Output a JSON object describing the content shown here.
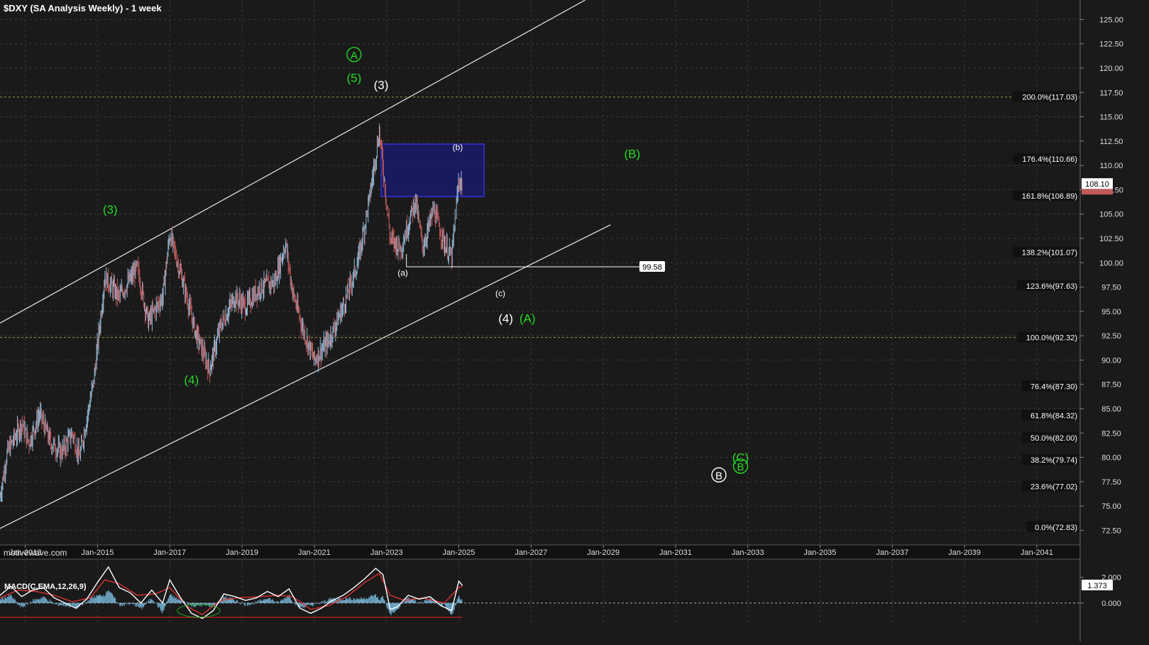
{
  "chart_title": "$DXY (SA Analysis Weekly) - 1 week",
  "watermark": "motivewave.com",
  "colors": {
    "background": "#1a1a1a",
    "grid": "#3a3a3a",
    "up_candle": "#8fb8d6",
    "down_candle": "#c05a5a",
    "green_label": "#22dd22",
    "fib_line": "#9a9a3a",
    "box_fill": "#1a1a6a",
    "box_border": "#3a3aff"
  },
  "chart_data": [
    {
      "type": "candlestick",
      "title": "$DXY (SA Analysis Weekly) - 1 week",
      "ylim": [
        71.0,
        127.0
      ],
      "y_ticks": [
        "125.00",
        "122.50",
        "120.00",
        "117.50",
        "115.00",
        "112.50",
        "110.00",
        "107.50",
        "105.00",
        "102.50",
        "100.00",
        "97.50",
        "95.00",
        "92.50",
        "90.00",
        "87.50",
        "85.00",
        "82.50",
        "80.00",
        "77.50",
        "75.00",
        "72.50"
      ],
      "x_tick_labels": [
        "Jan-2013",
        "Jan-2015",
        "Jan-2017",
        "Jan-2019",
        "Jan-2021",
        "Jan-2023",
        "Jan-2025",
        "Jan-2027",
        "Jan-2029",
        "Jan-2031",
        "Jan-2033",
        "Jan-2035",
        "Jan-2037",
        "Jan-2039",
        "Jan-2041"
      ],
      "x_tick_years": [
        2013,
        2015,
        2017,
        2019,
        2021,
        2023,
        2025,
        2027,
        2029,
        2031,
        2033,
        2035,
        2037,
        2039,
        2041
      ],
      "x_range_years": [
        2012.3,
        2042.2
      ],
      "price_path": [
        [
          2012.3,
          76.0
        ],
        [
          2012.5,
          80.5
        ],
        [
          2012.9,
          83.5
        ],
        [
          2013.1,
          81.5
        ],
        [
          2013.4,
          84.5
        ],
        [
          2013.7,
          81.5
        ],
        [
          2014.0,
          80.5
        ],
        [
          2014.3,
          82.5
        ],
        [
          2014.5,
          80.0
        ],
        [
          2014.9,
          88.0
        ],
        [
          2015.2,
          98.5
        ],
        [
          2015.6,
          96.5
        ],
        [
          2016.1,
          99.5
        ],
        [
          2016.4,
          94.0
        ],
        [
          2016.8,
          96.5
        ],
        [
          2017.0,
          103.0
        ],
        [
          2017.4,
          97.5
        ],
        [
          2017.7,
          93.0
        ],
        [
          2018.1,
          89.0
        ],
        [
          2018.4,
          93.5
        ],
        [
          2018.8,
          96.5
        ],
        [
          2019.1,
          95.5
        ],
        [
          2019.5,
          97.5
        ],
        [
          2019.9,
          98.0
        ],
        [
          2020.2,
          102.0
        ],
        [
          2020.4,
          97.0
        ],
        [
          2020.7,
          93.0
        ],
        [
          2021.0,
          90.0
        ],
        [
          2021.4,
          92.0
        ],
        [
          2021.8,
          95.5
        ],
        [
          2022.2,
          100.0
        ],
        [
          2022.5,
          106.0
        ],
        [
          2022.8,
          113.5
        ],
        [
          2023.1,
          102.5
        ],
        [
          2023.4,
          101.5
        ],
        [
          2023.8,
          106.5
        ],
        [
          2024.0,
          101.5
        ],
        [
          2024.3,
          105.5
        ],
        [
          2024.6,
          102.0
        ],
        [
          2024.8,
          100.5
        ],
        [
          2025.0,
          108.5
        ],
        [
          2025.1,
          108.1
        ]
      ],
      "last_price": "108.10",
      "last_price_value": 108.1,
      "prior_price_value": 107.52,
      "fib_levels": [
        {
          "label": "200.0%(117.03)",
          "value": 117.03
        },
        {
          "label": "176.4%(110.66)",
          "value": 110.66
        },
        {
          "label": "161.8%(106.89)",
          "value": 106.89
        },
        {
          "label": "138.2%(101.07)",
          "value": 101.07
        },
        {
          "label": "123.6%(97.63)",
          "value": 97.63
        },
        {
          "label": "100.0%(92.32)",
          "value": 92.32
        },
        {
          "label": "76.4%(87.30)",
          "value": 87.3
        },
        {
          "label": "61.8%(84.32)",
          "value": 84.32
        },
        {
          "label": "50.0%(82.00)",
          "value": 82.0
        },
        {
          "label": "38.2%(79.74)",
          "value": 79.74
        },
        {
          "label": "23.6%(77.02)",
          "value": 77.02
        },
        {
          "label": "0.0%(72.83)",
          "value": 72.83
        }
      ],
      "dotted_levels": [
        117.03,
        92.32
      ],
      "channel": {
        "upper": [
          [
            2012.3,
            93.8
          ],
          [
            2028.5,
            127.0
          ]
        ],
        "lower": [
          [
            2012.3,
            72.7
          ],
          [
            2029.2,
            103.9
          ]
        ]
      },
      "target_box": {
        "x0": 2022.85,
        "x1": 2025.7,
        "y0": 106.8,
        "y1": 112.2
      },
      "support_line": {
        "from_year": 2023.55,
        "to_year": 2030.0,
        "value": 99.58,
        "label": "99.58"
      },
      "wave_labels": [
        {
          "text": "A",
          "year": 2022.1,
          "value": 121.4,
          "color": "green",
          "circled": true
        },
        {
          "text": "(5)",
          "year": 2022.1,
          "value": 119.0,
          "color": "green",
          "circled": false
        },
        {
          "text": "(3)",
          "year": 2022.85,
          "value": 118.3,
          "color": "white",
          "circled": false
        },
        {
          "text": "(b)",
          "year": 2024.97,
          "value": 112.0,
          "color": "white",
          "circled": false,
          "small": true
        },
        {
          "text": "(B)",
          "year": 2029.8,
          "value": 111.2,
          "color": "green",
          "circled": false
        },
        {
          "text": "(3)",
          "year": 2015.35,
          "value": 105.5,
          "color": "green",
          "circled": false
        },
        {
          "text": "(a)",
          "year": 2023.45,
          "value": 99.1,
          "color": "white",
          "circled": false,
          "small": true
        },
        {
          "text": "(c)",
          "year": 2026.15,
          "value": 97.0,
          "color": "white",
          "circled": false,
          "small": true
        },
        {
          "text": "(4)",
          "year": 2026.3,
          "value": 94.3,
          "color": "white",
          "circled": false
        },
        {
          "text": "(A)",
          "year": 2026.9,
          "value": 94.3,
          "color": "green",
          "circled": false
        },
        {
          "text": "(4)",
          "year": 2017.6,
          "value": 88.0,
          "color": "green",
          "circled": false
        },
        {
          "text": "(C)",
          "year": 2032.8,
          "value": 80.0,
          "color": "green",
          "circled": false
        },
        {
          "text": "B",
          "year": 2032.8,
          "value": 79.1,
          "color": "green",
          "circled": true
        },
        {
          "text": "B",
          "year": 2032.2,
          "value": 78.2,
          "color": "white",
          "circled": true
        }
      ]
    },
    {
      "type": "line",
      "title": "MACD(C,EMA,12,26,9)",
      "ylim": [
        -1.5,
        3.3
      ],
      "y_ticks": [
        "2.000",
        "0.000"
      ],
      "last_value": "1.373",
      "last_value_num": 1.373,
      "series": [
        {
          "name": "MACD",
          "values": [
            [
              2012.3,
              0.6
            ],
            [
              2012.6,
              1.3
            ],
            [
              2012.9,
              0.5
            ],
            [
              2013.2,
              1.0
            ],
            [
              2013.5,
              1.2
            ],
            [
              2013.8,
              0.4
            ],
            [
              2014.1,
              0.0
            ],
            [
              2014.4,
              -0.4
            ],
            [
              2014.7,
              0.3
            ],
            [
              2015.0,
              1.6
            ],
            [
              2015.3,
              2.8
            ],
            [
              2015.6,
              1.2
            ],
            [
              2015.9,
              0.8
            ],
            [
              2016.2,
              0.0
            ],
            [
              2016.5,
              1.0
            ],
            [
              2016.8,
              0.0
            ],
            [
              2017.0,
              1.8
            ],
            [
              2017.3,
              0.4
            ],
            [
              2017.6,
              -0.8
            ],
            [
              2017.9,
              -1.2
            ],
            [
              2018.2,
              -0.6
            ],
            [
              2018.5,
              0.7
            ],
            [
              2018.8,
              0.5
            ],
            [
              2019.1,
              0.2
            ],
            [
              2019.4,
              0.4
            ],
            [
              2019.7,
              0.9
            ],
            [
              2020.0,
              0.5
            ],
            [
              2020.3,
              1.1
            ],
            [
              2020.6,
              -0.4
            ],
            [
              2020.9,
              -0.8
            ],
            [
              2021.2,
              -0.4
            ],
            [
              2021.5,
              0.2
            ],
            [
              2021.8,
              0.6
            ],
            [
              2022.1,
              1.2
            ],
            [
              2022.4,
              1.9
            ],
            [
              2022.7,
              2.7
            ],
            [
              2022.9,
              2.2
            ],
            [
              2023.1,
              -0.5
            ],
            [
              2023.3,
              -0.3
            ],
            [
              2023.6,
              0.6
            ],
            [
              2023.9,
              0.3
            ],
            [
              2024.2,
              0.5
            ],
            [
              2024.5,
              -0.2
            ],
            [
              2024.8,
              -0.6
            ],
            [
              2025.0,
              1.7
            ],
            [
              2025.1,
              1.37
            ]
          ]
        },
        {
          "name": "Signal",
          "values": [
            [
              2012.3,
              0.4
            ],
            [
              2012.8,
              1.0
            ],
            [
              2013.3,
              0.9
            ],
            [
              2013.8,
              0.6
            ],
            [
              2014.3,
              0.1
            ],
            [
              2014.8,
              0.4
            ],
            [
              2015.2,
              1.8
            ],
            [
              2015.6,
              1.5
            ],
            [
              2016.1,
              0.6
            ],
            [
              2016.6,
              0.7
            ],
            [
              2017.0,
              1.2
            ],
            [
              2017.5,
              -0.3
            ],
            [
              2017.9,
              -0.9
            ],
            [
              2018.4,
              0.2
            ],
            [
              2018.9,
              0.4
            ],
            [
              2019.5,
              0.5
            ],
            [
              2020.0,
              0.6
            ],
            [
              2020.4,
              0.5
            ],
            [
              2020.9,
              -0.5
            ],
            [
              2021.4,
              -0.2
            ],
            [
              2021.9,
              0.5
            ],
            [
              2022.4,
              1.6
            ],
            [
              2022.8,
              2.3
            ],
            [
              2023.1,
              0.6
            ],
            [
              2023.5,
              0.2
            ],
            [
              2024.0,
              0.4
            ],
            [
              2024.6,
              0.0
            ],
            [
              2025.0,
              1.2
            ],
            [
              2025.1,
              1.3
            ]
          ]
        }
      ]
    }
  ]
}
